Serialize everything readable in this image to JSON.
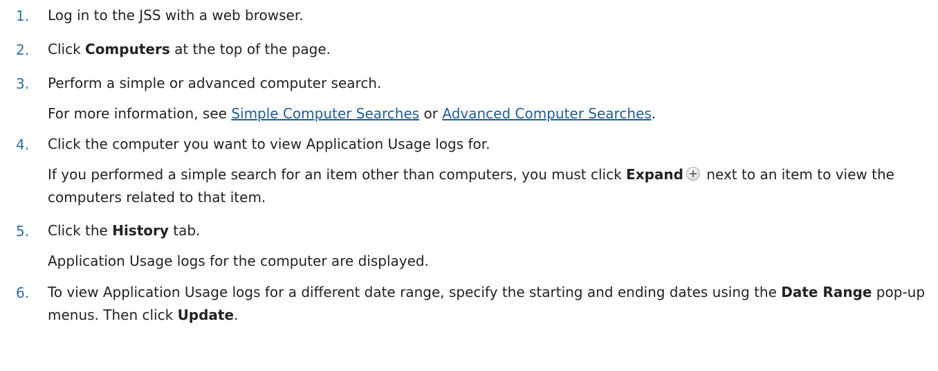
{
  "steps": [
    {
      "number": "1.",
      "text": "Log in to the JSS with a web browser."
    },
    {
      "number": "2.",
      "pre": "Click ",
      "bold": "Computers",
      "post": " at the top of the page."
    },
    {
      "number": "3.",
      "text": "Perform a simple or advanced computer search.",
      "note_pre": "For more information, see ",
      "link1": "Simple Computer Searches",
      "note_mid": " or ",
      "link2": "Advanced Computer Searches",
      "note_post": "."
    },
    {
      "number": "4.",
      "text": "Click the computer you want to view Application Usage logs for.",
      "note_pre": "If you performed a simple search for an item other than computers, you must click ",
      "bold": "Expand",
      "icon": "plus-icon",
      "note_post": " next to an item to view the computers related to that item."
    },
    {
      "number": "5.",
      "pre": "Click the ",
      "bold": "History",
      "post": " tab.",
      "note": "Application Usage logs for the computer are displayed."
    },
    {
      "number": "6.",
      "pre": "To view Application Usage logs for a different date range, specify the starting and ending dates using the ",
      "bold1": "Date Range",
      "mid": " pop-up menus. Then click ",
      "bold2": "Update",
      "post": "."
    }
  ]
}
